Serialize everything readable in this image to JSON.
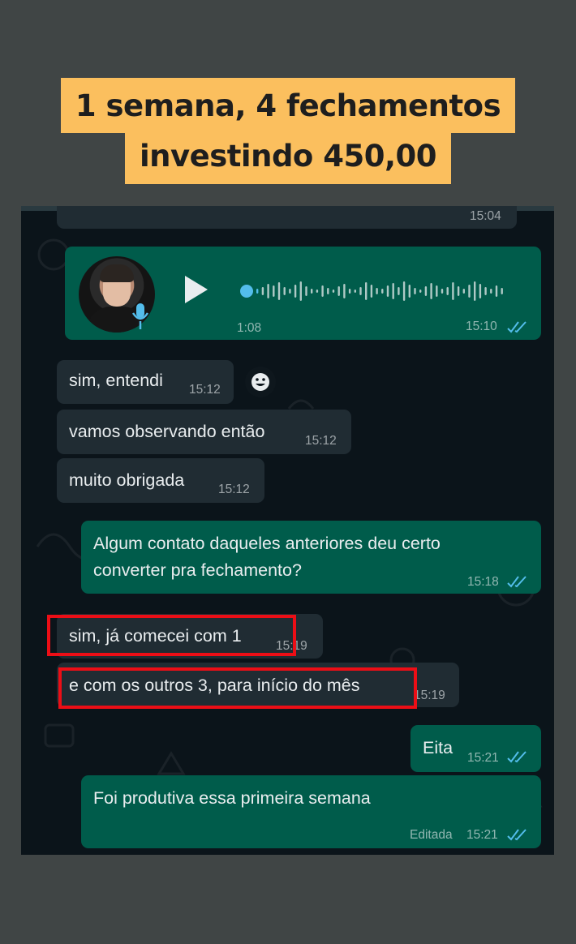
{
  "headline": {
    "line1": "1 semana, 4 fechamentos",
    "line2": "investindo 450,00"
  },
  "chat": {
    "prev_time": "15:04",
    "voice_note": {
      "duration": "1:08",
      "time": "15:10",
      "icons": [
        "avatar",
        "mic-icon",
        "play-icon",
        "waveform",
        "read-ticks-icon"
      ]
    },
    "messages": [
      {
        "dir": "in",
        "text": "sim, entendi",
        "time": "15:12",
        "reaction_icon": "emoji-icon"
      },
      {
        "dir": "in",
        "text": "vamos observando então",
        "time": "15:12"
      },
      {
        "dir": "in",
        "text": "muito obrigada",
        "time": "15:12"
      },
      {
        "dir": "out",
        "lines": [
          "Algum contato daqueles anteriores deu certo",
          "converter pra fechamento?"
        ],
        "time": "15:18"
      },
      {
        "dir": "in",
        "text": "sim, já comecei com 1",
        "time": "15:19",
        "highlighted": true
      },
      {
        "dir": "in",
        "text": "e com os outros 3, para início do mês",
        "time": "15:19",
        "highlighted": true
      },
      {
        "dir": "out",
        "text": "Eita",
        "time": "15:21"
      },
      {
        "dir": "out",
        "text": "Foi produtiva essa primeira semana",
        "edited_label": "Editada",
        "time": "15:21"
      }
    ],
    "colors": {
      "background": "#0b141a",
      "incoming_bubble": "#202c33",
      "outgoing_bubble": "#005c4b",
      "read_ticks": "#53bdeb",
      "highlight_box": "#ec0e16",
      "headline_bg": "#fbbf5e",
      "page_bg": "#404545"
    }
  }
}
